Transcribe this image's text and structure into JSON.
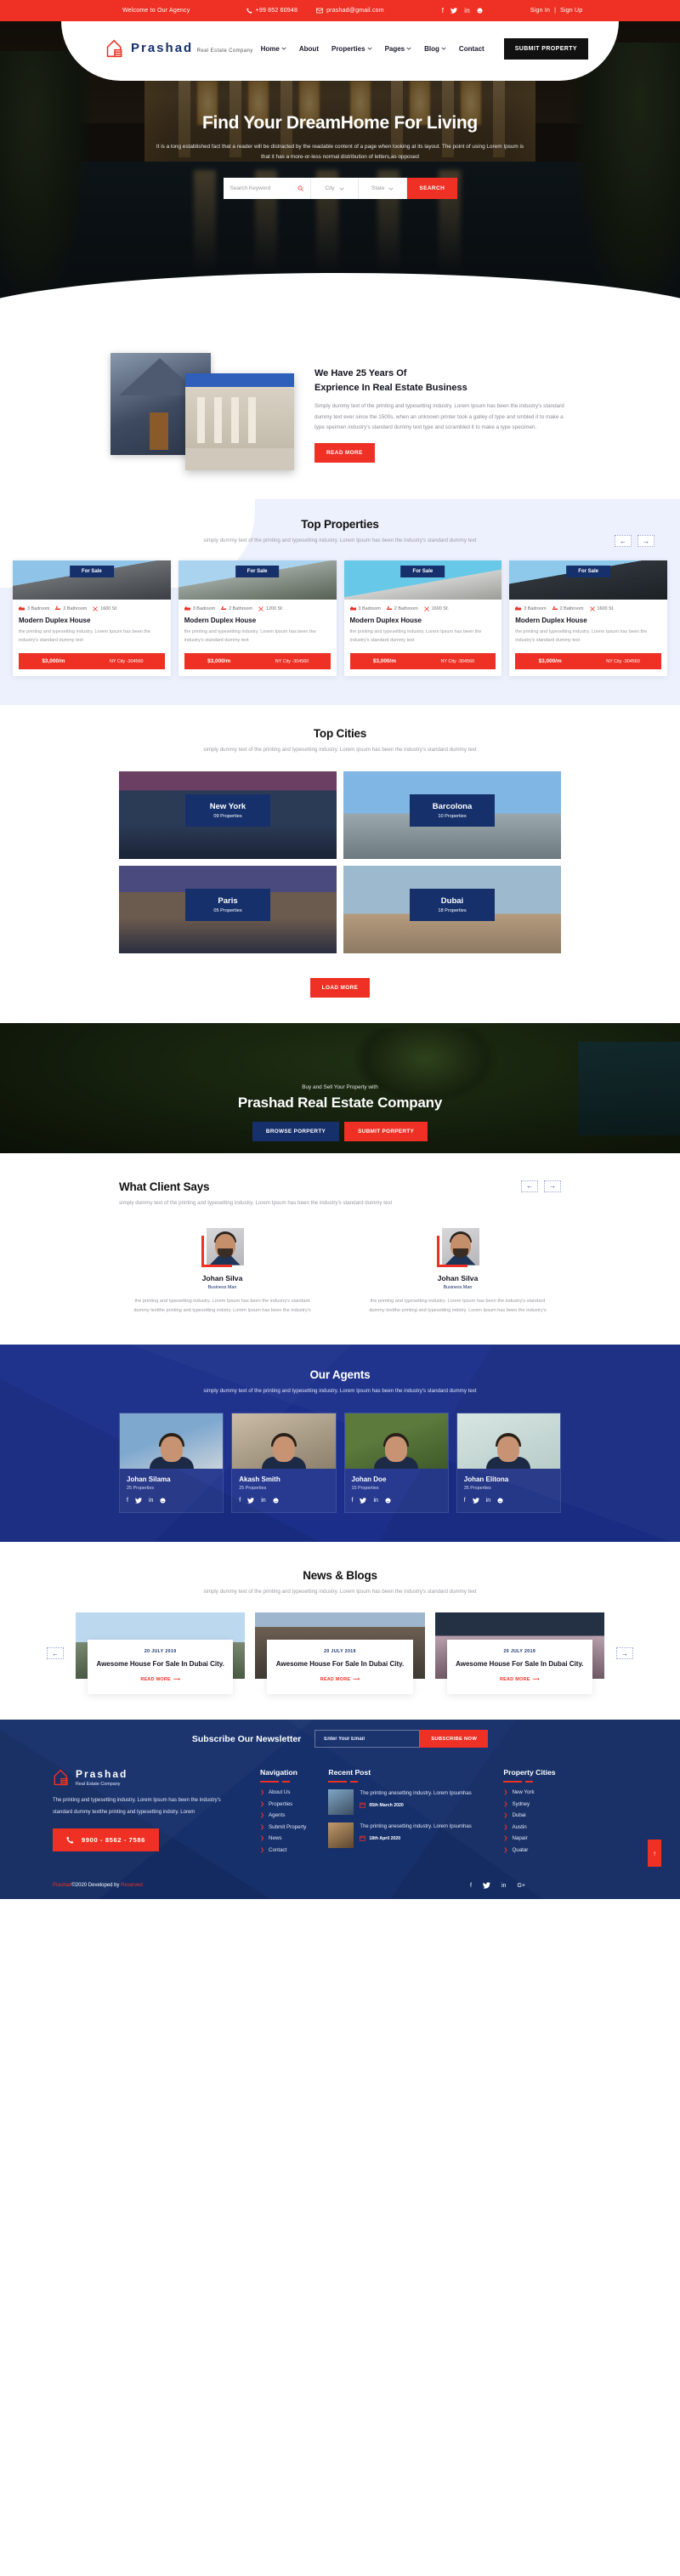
{
  "topbar": {
    "welcome": "Welcome to Our Agency",
    "phone": "+99 852 60948",
    "email": "prashad@gmail.com",
    "social": [
      "facebook-icon",
      "twitter-icon",
      "linkedin-icon",
      "skype-icon"
    ],
    "sign_in": "Sign In",
    "divider": "|",
    "sign_up": "Sign Up"
  },
  "brand": {
    "name": "Prashad",
    "tagline": "Real Estate Company"
  },
  "nav": {
    "items": [
      {
        "label": "Home",
        "caret": true
      },
      {
        "label": "About",
        "caret": false
      },
      {
        "label": "Properties",
        "caret": true
      },
      {
        "label": "Pages",
        "caret": true
      },
      {
        "label": "Blog",
        "caret": true
      },
      {
        "label": "Contact",
        "caret": false
      }
    ],
    "submit_property": "SUBMIT PROPERTY"
  },
  "hero": {
    "title_part1": "Find Your Dream",
    "title_part2": "Home For Living",
    "paragraph": "It is a long established fact that a reader will be distracted by the readable content of a page when looking at its layout. The point of using Lorem Ipsum is that it has a more-or-less normal distribution of letters,as opposed",
    "search_placeholder": "Search Keyword",
    "city_label": "City",
    "state_label": "State",
    "search_button": "SEARCH"
  },
  "about": {
    "heading_line1": "We Have 25 Years Of",
    "heading_line2": "Exprience In Real Estate Business",
    "paragraph": "Simply dummy text of the printing and typesetting industry. Lorem Ipsum has been the industry's standard dummy text ever since the 1500s, when an unknown printer took a galley of type and smbled it to make a type speimen industry's standard dummy text type and scrambled it to make a type specimen.",
    "read_more": "READ MORE"
  },
  "top_properties": {
    "title": "Top Properties",
    "subtitle": "simply dummy text of the printing and typesetting industry. Lorem Ipsum has been the industry's standard dummy text",
    "prev_icon": "arrow-left-icon",
    "next_icon": "arrow-right-icon",
    "cards": [
      {
        "badge": "For Sale",
        "bedroom": "3 Badroom",
        "bathroom": "2 Bathroom",
        "area": "1600 Sf.",
        "title": "Modern Duplex House",
        "desc": "the printing and typesetting industry. Lorem Ipsum has been the industry's standard dummy text",
        "price": "$3,000/m",
        "location": "NY City -304560"
      },
      {
        "badge": "For Sale",
        "bedroom": "3 Badroom",
        "bathroom": "2 Bathroom",
        "area": "1200 Sf.",
        "title": "Modern Duplex House",
        "desc": "the printing and typesetting industry. Lorem Ipsum has been the industry's standard dummy text",
        "price": "$3,000/m",
        "location": "NY City -304560"
      },
      {
        "badge": "For Sale",
        "bedroom": "3 Badroom",
        "bathroom": "2 Bathroom",
        "area": "1600 Sf.",
        "title": "Modern Duplex House",
        "desc": "the printing and typesetting industry. Lorem Ipsum has been the industry's standard dummy text",
        "price": "$3,000/m",
        "location": "NY City -304560"
      },
      {
        "badge": "For Sale",
        "bedroom": "3 Badroom",
        "bathroom": "2 Bathroom",
        "area": "1600 Sf.",
        "title": "Modern Duplex House",
        "desc": "the printing and typesetting industry. Lorem Ipsum has been the industry's standard dummy text",
        "price": "$3,000/m",
        "location": "NY City -304560"
      }
    ]
  },
  "top_cities": {
    "title": "Top Cities",
    "subtitle": "simply dummy text of the printing and typesetting industry. Lorem Ipsum has been the industry's standard dummy text",
    "items": [
      {
        "name": "New York",
        "count": "09 Properties"
      },
      {
        "name": "Barcolona",
        "count": "10 Properties"
      },
      {
        "name": "Paris",
        "count": "05 Properties"
      },
      {
        "name": "Dubai",
        "count": "18 Properties"
      }
    ],
    "load_more": "LOAD MORE"
  },
  "cta": {
    "eyebrow": "Buy and Sell Your Property with",
    "heading": "Prashad Real Estate Company",
    "browse": "BROWSE PORPERTY",
    "submit": "SUBMIT PORPERTY"
  },
  "testimonials": {
    "title": "What Client Says",
    "subtitle": "simply dummy text of the printing and typesetting industry. Lorem Ipsum has been the industry's standard dummy text",
    "prev_icon": "arrow-left-icon",
    "next_icon": "arrow-right-icon",
    "items": [
      {
        "name": "Johan Silva",
        "role": "Business Man",
        "quote": "the printing and typesetting industry. Lorem Ipsum has been the industry's standard dummy textthe printing and typesetting indstry. Lorem Ipsum has been the industry's"
      },
      {
        "name": "Johan Silva",
        "role": "Business Man",
        "quote": "the printing and typesetting industry. Lorem Ipsum has been the industry's standard dummy textthe printing and typesetting indstry. Lorem Ipsum has been the industry's"
      }
    ]
  },
  "agents": {
    "title": "Our Agents",
    "subtitle": "simply dummy text of the printing and typesetting industry. Lorem Ipsum has been the industry's standard dummy text",
    "items": [
      {
        "name": "Johan Silama",
        "count": "25 Properties"
      },
      {
        "name": "Akash Smith",
        "count": "25 Properties"
      },
      {
        "name": "Johan Doe",
        "count": "15 Properties"
      },
      {
        "name": "Johan Elitona",
        "count": "35 Properties"
      }
    ],
    "social": [
      "facebook-icon",
      "twitter-icon",
      "linkedin-icon",
      "skype-icon"
    ]
  },
  "news": {
    "title": "News & Blogs",
    "subtitle": "simply dummy text of the printing and typesetting industry. Lorem Ipsum has been the industry's standard dummy text",
    "prev_icon": "arrow-left-icon",
    "next_icon": "arrow-right-icon",
    "items": [
      {
        "date": "20 JULY 2019",
        "title": "Awesome House For Sale In Dubai City.",
        "read_more": "READ MORE"
      },
      {
        "date": "20 JULY 2019",
        "title": "Awesome House For Sale In Dubai City.",
        "read_more": "READ MORE"
      },
      {
        "date": "20 JULY 2019",
        "title": "Awesome House For Sale In Dubai City.",
        "read_more": "READ MORE"
      }
    ]
  },
  "newsletter": {
    "heading": "Subscribe Our Newsletter",
    "placeholder": "Enter Your Email",
    "button": "SUBSCRIBE NOW"
  },
  "footer": {
    "about_text": "The printing and typesetting industry. Lorem Ipsum has been the industry's standard dummy textthe printing and typesetting indstry. Lorem",
    "phone": "9900 - 8562 - 7586",
    "navigation": {
      "title": "Navigation",
      "items": [
        "About Us",
        "Properties",
        "Agents",
        "Submit Property",
        "News",
        "Contact"
      ]
    },
    "recent_post": {
      "title": "Recent Post",
      "items": [
        {
          "text": "The printing anesetting industry. Lorem Ipsumhas",
          "date": "05th March 2020"
        },
        {
          "text": "The printing anesetting industry. Lorem Ipsumhas",
          "date": "18th April 2020"
        }
      ]
    },
    "property_cities": {
      "title": "Property Cities",
      "items": [
        "New York",
        "Sydney",
        "Dubai",
        "Austin",
        "Napair",
        "Quatar"
      ]
    },
    "copyright_brand": "Prashad",
    "copyright_mid": "©2020 Developed by ",
    "copyright_reserved": "Reserved",
    "social": [
      "facebook-icon",
      "twitter-icon",
      "linkedin-icon",
      "google-plus-icon"
    ],
    "to_top_icon": "arrow-up-icon"
  },
  "colors": {
    "accent_red": "#ee3124",
    "brand_blue": "#16306b",
    "agents_blue": "#1b2f8a"
  }
}
